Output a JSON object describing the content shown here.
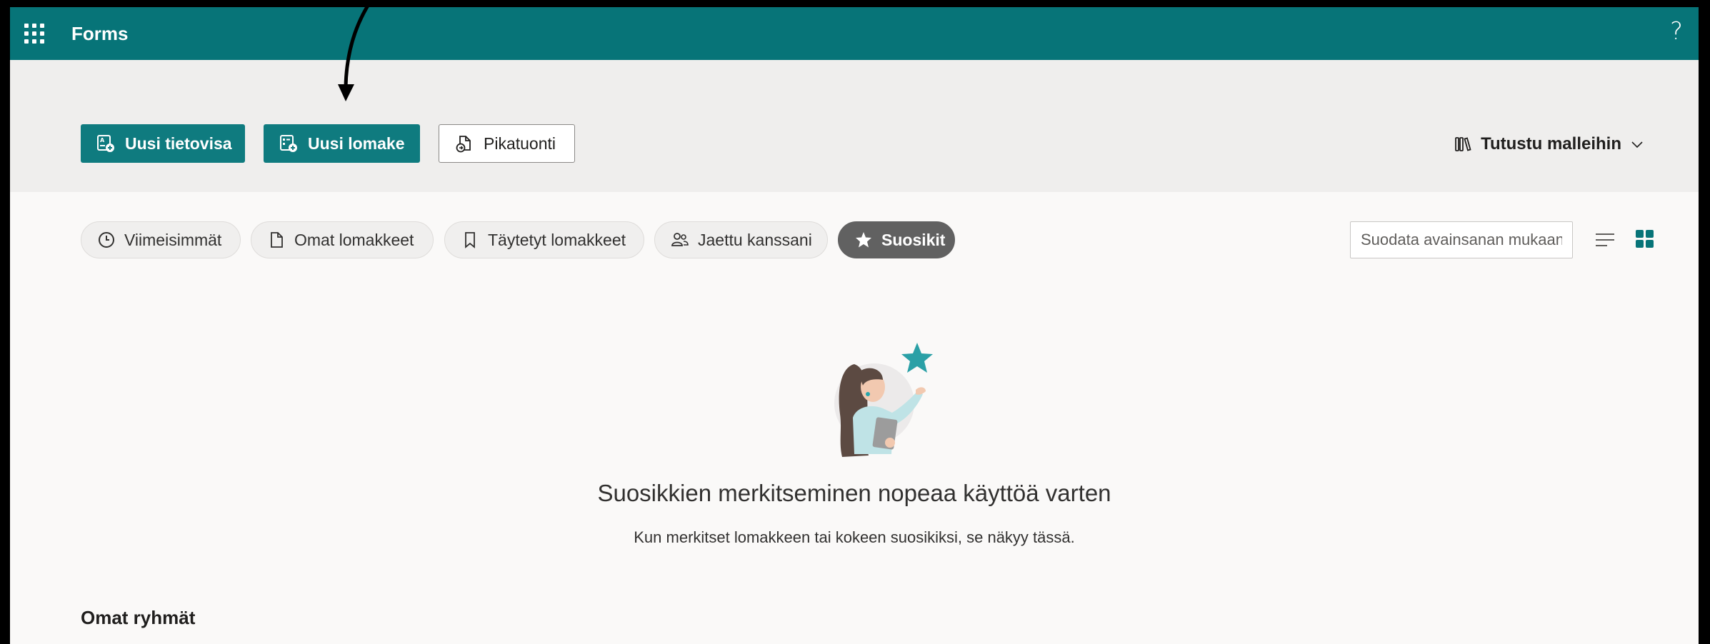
{
  "header": {
    "app_title": "Forms",
    "help_label": "?"
  },
  "commands": {
    "new_quiz": "Uusi tietovisa",
    "new_form": "Uusi lomake",
    "quick_import": "Pikatuonti",
    "templates": "Tutustu malleihin"
  },
  "pivots": [
    {
      "label": "Viimeisimmät",
      "icon": "clock-icon",
      "active": false
    },
    {
      "label": "Omat lomakkeet",
      "icon": "document-icon",
      "active": false
    },
    {
      "label": "Täytetyt lomakkeet",
      "icon": "bookmark-icon",
      "active": false
    },
    {
      "label": "Jaettu kanssani",
      "icon": "people-icon",
      "active": false
    },
    {
      "label": "Suosikit",
      "icon": "star-icon",
      "active": true
    }
  ],
  "search": {
    "placeholder": "Suodata avainsanan mukaan"
  },
  "empty_state": {
    "title": "Suosikkien merkitseminen nopeaa käyttöä varten",
    "subtitle": "Kun merkitset lomakkeen tai kokeen suosikiksi, se näkyy tässä."
  },
  "groups": {
    "title": "Omat ryhmät"
  },
  "colors": {
    "brand": "#077478",
    "button_primary": "#0f7b7f",
    "active_pill": "#616161",
    "grid_icon": "#077478"
  }
}
